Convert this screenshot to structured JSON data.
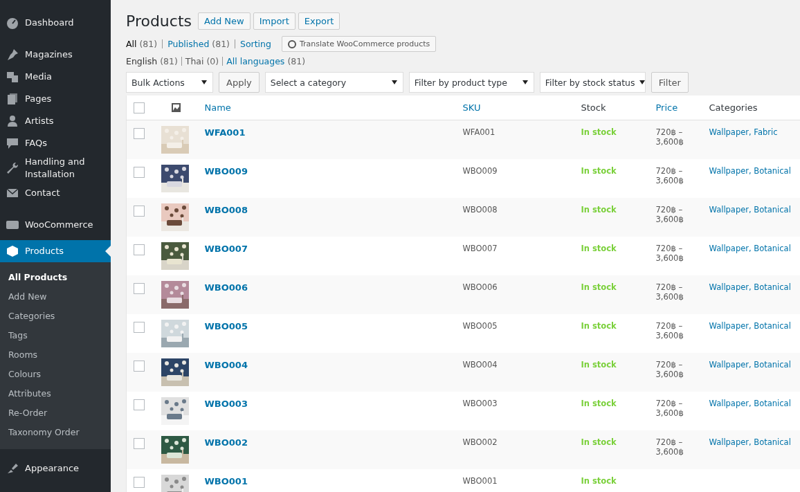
{
  "sidebar": {
    "items": [
      {
        "label": "Dashboard",
        "selected": false
      },
      {
        "label": "Magazines",
        "selected": false
      },
      {
        "label": "Media",
        "selected": false
      },
      {
        "label": "Pages",
        "selected": false
      },
      {
        "label": "Artists",
        "selected": false
      },
      {
        "label": "FAQs",
        "selected": false
      },
      {
        "label": "Handling and Installation",
        "selected": false
      },
      {
        "label": "Contact",
        "selected": false
      },
      {
        "label": "WooCommerce",
        "selected": false
      },
      {
        "label": "Products",
        "selected": true,
        "children": [
          {
            "label": "All Products",
            "selected": true
          },
          {
            "label": "Add New",
            "selected": false
          },
          {
            "label": "Categories",
            "selected": false
          },
          {
            "label": "Tags",
            "selected": false
          },
          {
            "label": "Rooms",
            "selected": false
          },
          {
            "label": "Colours",
            "selected": false
          },
          {
            "label": "Attributes",
            "selected": false
          },
          {
            "label": "Re-Order",
            "selected": false
          },
          {
            "label": "Taxonomy Order",
            "selected": false
          }
        ]
      },
      {
        "label": "Appearance",
        "selected": false
      }
    ]
  },
  "page": {
    "title": "Products",
    "actions": [
      "Add New",
      "Import",
      "Export"
    ],
    "status_views": [
      {
        "label": "All",
        "count": "(81)",
        "selected": true
      },
      {
        "label": "Published",
        "count": "(81)",
        "selected": false
      },
      {
        "label": "Sorting",
        "selected": false
      }
    ],
    "translate_button": "Translate WooCommerce products",
    "language_views": [
      {
        "label": "English",
        "count": "(81)",
        "kind": "current"
      },
      {
        "label": "Thai",
        "count": "(0)",
        "kind": "text"
      },
      {
        "label": "All languages",
        "count": "(81)",
        "kind": "link"
      }
    ],
    "bulk_actions": "Bulk Actions",
    "apply": "Apply",
    "filters": [
      "Select a category",
      "Filter by product type",
      "Filter by stock status"
    ],
    "filter_button": "Filter"
  },
  "table": {
    "select_all_checked": false,
    "columns": [
      "Name",
      "SKU",
      "Stock",
      "Price",
      "Categories"
    ],
    "rows": [
      {
        "name": "WFA001",
        "sku": "WFA001",
        "stock": "In stock",
        "price": "720฿ – 3,600฿",
        "categories": "Wallpaper, Fabric",
        "checked": false
      },
      {
        "name": "WBO009",
        "sku": "WBO009",
        "stock": "In stock",
        "price": "720฿ – 3,600฿",
        "categories": "Wallpaper, Botanical",
        "checked": false
      },
      {
        "name": "WBO008",
        "sku": "WBO008",
        "stock": "In stock",
        "price": "720฿ – 3,600฿",
        "categories": "Wallpaper, Botanical",
        "checked": false
      },
      {
        "name": "WBO007",
        "sku": "WBO007",
        "stock": "In stock",
        "price": "720฿ – 3,600฿",
        "categories": "Wallpaper, Botanical",
        "checked": false
      },
      {
        "name": "WBO006",
        "sku": "WBO006",
        "stock": "In stock",
        "price": "720฿ – 3,600฿",
        "categories": "Wallpaper, Botanical",
        "checked": false
      },
      {
        "name": "WBO005",
        "sku": "WBO005",
        "stock": "In stock",
        "price": "720฿ – 3,600฿",
        "categories": "Wallpaper, Botanical",
        "checked": false
      },
      {
        "name": "WBO004",
        "sku": "WBO004",
        "stock": "In stock",
        "price": "720฿ – 3,600฿",
        "categories": "Wallpaper, Botanical",
        "checked": false
      },
      {
        "name": "WBO003",
        "sku": "WBO003",
        "stock": "In stock",
        "price": "720฿ – 3,600฿",
        "categories": "Wallpaper, Botanical",
        "checked": false
      },
      {
        "name": "WBO002",
        "sku": "WBO002",
        "stock": "In stock",
        "price": "720฿ – 3,600฿",
        "categories": "Wallpaper, Botanical",
        "checked": false
      },
      {
        "name": "WBO001",
        "sku": "WBO001",
        "stock": "In stock",
        "checked": false
      }
    ]
  }
}
